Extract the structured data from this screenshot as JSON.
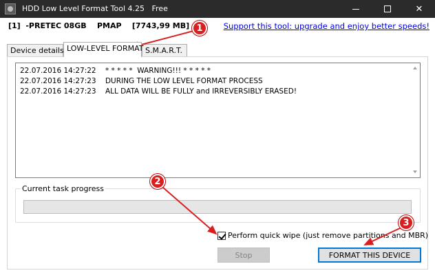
{
  "window": {
    "title": "HDD Low Level Format Tool 4.25   Free"
  },
  "device": {
    "info": "[1]  -PRETEC 08GB    PMAP    [7743,99 MB]"
  },
  "support_link": "Support this tool: upgrade and enjoy better speeds!",
  "tabs": [
    {
      "label": "Device details"
    },
    {
      "label": "LOW-LEVEL FORMAT"
    },
    {
      "label": "S.M.A.R.T."
    }
  ],
  "log": [
    "22.07.2016 14:27:22    * * * * *  WARNING!!! * * * * *",
    "22.07.2016 14:27:23    DURING THE LOW LEVEL FORMAT PROCESS",
    "22.07.2016 14:27:23    ALL DATA WILL BE FULLY and IRREVERSIBLY ERASED!"
  ],
  "progress": {
    "label": "Current task progress",
    "value": 0
  },
  "quick_wipe": {
    "label": "Perform quick wipe (just remove partitions and MBR)",
    "checked": true
  },
  "buttons": {
    "stop": "Stop",
    "format": "FORMAT THIS DEVICE"
  },
  "callouts": [
    "1",
    "2",
    "3"
  ],
  "colors": {
    "titlebar": "#2b2b2b",
    "link": "#0000e0",
    "callout": "#d81f1f",
    "focus_border": "#0078d7"
  }
}
